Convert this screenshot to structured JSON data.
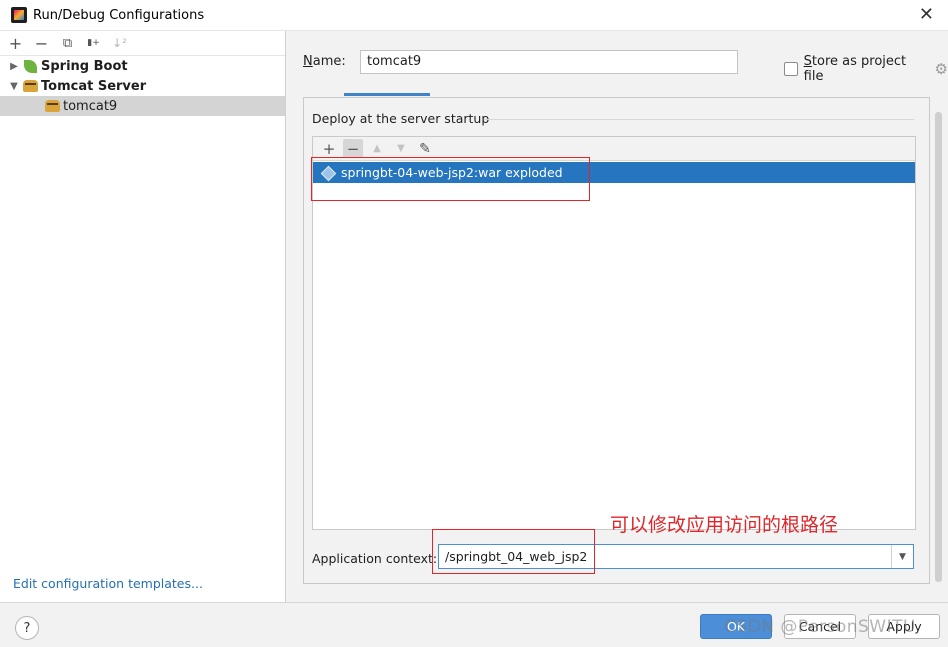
{
  "window": {
    "title": "Run/Debug Configurations"
  },
  "left": {
    "toolbar": [
      "+",
      "−",
      "⧉",
      "▮+",
      "↓²"
    ],
    "tree": [
      {
        "label": "Spring Boot",
        "expanded": false
      },
      {
        "label": "Tomcat Server",
        "expanded": true
      },
      {
        "label": "tomcat9",
        "selected": true
      }
    ],
    "edit_templates_link": "Edit configuration templates..."
  },
  "form": {
    "name_label_prefix": "N",
    "name_label_rest": "ame:",
    "name_value": "tomcat9",
    "store_label_prefix": "S",
    "store_label_rest": "tore as project file",
    "store_checked": false
  },
  "deploy": {
    "section_title": "Deploy at the server startup",
    "toolbar": {
      "add": "+",
      "remove": "−",
      "up": "▲",
      "down": "▼",
      "edit": "✎"
    },
    "artifacts": [
      "springbt-04-web-jsp2:war exploded"
    ],
    "context_label": "Application context:",
    "context_value": "/springbt_04_web_jsp2"
  },
  "annotation": {
    "text": "可以修改应用访问的根路径",
    "color": "#e0262a"
  },
  "footer": {
    "help": "?",
    "ok": "OK",
    "cancel": "Cancel",
    "apply": "Apply",
    "watermark": "CSDN @PersonSWITU"
  },
  "colors": {
    "accent": "#2675bf",
    "ok_button": "#4c8fd8",
    "link": "#2470b3"
  }
}
